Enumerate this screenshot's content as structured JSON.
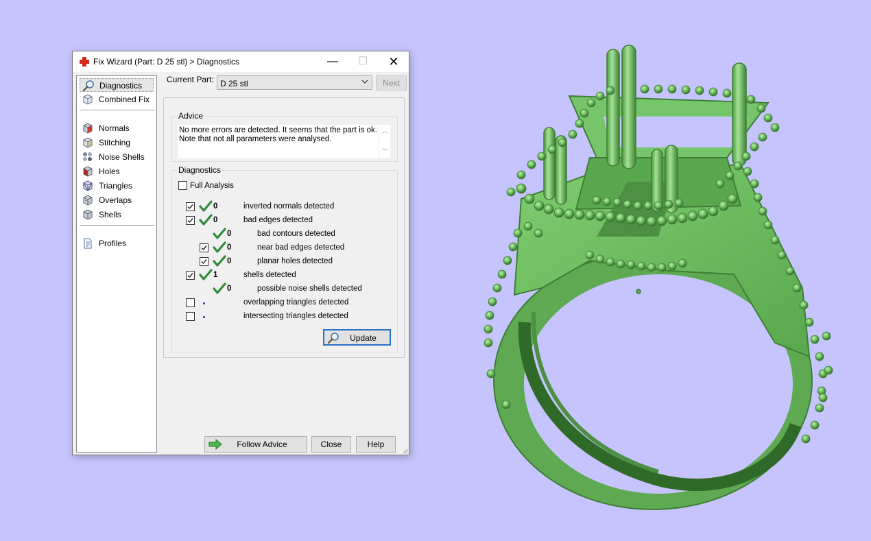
{
  "window": {
    "title": "Fix Wizard (Part: D 25 stl) > Diagnostics",
    "minimize": "—",
    "maximize": "☐",
    "close": "✕"
  },
  "sidebar": {
    "items": [
      {
        "label": "Diagnostics",
        "icon": "magnifier-icon",
        "selected": true
      },
      {
        "label": "Combined Fix",
        "icon": "cube-icon"
      },
      {
        "label": "Normals",
        "icon": "cube-red-icon"
      },
      {
        "label": "Stitching",
        "icon": "cube-stitch-icon"
      },
      {
        "label": "Noise Shells",
        "icon": "cube-noise-icon"
      },
      {
        "label": "Holes",
        "icon": "cube-holes-icon"
      },
      {
        "label": "Triangles",
        "icon": "cube-triangles-icon"
      },
      {
        "label": "Overlaps",
        "icon": "cube-overlap-icon"
      },
      {
        "label": "Shells",
        "icon": "cube-shells-icon"
      },
      {
        "label": "Profiles",
        "icon": "document-icon"
      }
    ]
  },
  "part": {
    "label": "Current Part:",
    "selected": "D 25 stl",
    "next_label": "Next"
  },
  "advice": {
    "title": "Advice",
    "line1": "No more errors are detected. It seems that the part is ok.",
    "line2": "Note that not all parameters were analysed."
  },
  "diagnostics": {
    "title": "Diagnostics",
    "full_analysis_label": "Full Analysis",
    "full_analysis_checked": false,
    "rows": [
      {
        "checkbox": true,
        "checked": true,
        "status": "ok",
        "count": "0",
        "label": "inverted normals detected",
        "indent": 0
      },
      {
        "checkbox": true,
        "checked": true,
        "status": "ok",
        "count": "0",
        "label": "bad edges detected",
        "indent": 0
      },
      {
        "checkbox": false,
        "checked": false,
        "status": "ok",
        "count": "0",
        "label": "bad contours detected",
        "indent": 1
      },
      {
        "checkbox": true,
        "checked": true,
        "status": "ok",
        "count": "0",
        "label": "near bad edges detected",
        "indent": 1
      },
      {
        "checkbox": true,
        "checked": true,
        "status": "ok",
        "count": "0",
        "label": "planar holes detected",
        "indent": 1
      },
      {
        "checkbox": true,
        "checked": true,
        "status": "ok",
        "count": "1",
        "label": "shells detected",
        "indent": 0
      },
      {
        "checkbox": false,
        "checked": false,
        "status": "ok",
        "count": "0",
        "label": "possible noise shells detected",
        "indent": 1
      },
      {
        "checkbox": true,
        "checked": false,
        "status": "pending",
        "count": "",
        "label": "overlapping triangles detected",
        "indent": 0
      },
      {
        "checkbox": true,
        "checked": false,
        "status": "pending",
        "count": "",
        "label": "intersecting triangles detected",
        "indent": 0
      }
    ],
    "update_label": "Update"
  },
  "buttons": {
    "follow_advice": "Follow Advice",
    "close": "Close",
    "help": "Help"
  },
  "colors": {
    "background": "#c6c4fc",
    "model_green": "#6cbd5f",
    "check_green": "#2e8b3a",
    "focus_blue": "#2a72c6"
  }
}
